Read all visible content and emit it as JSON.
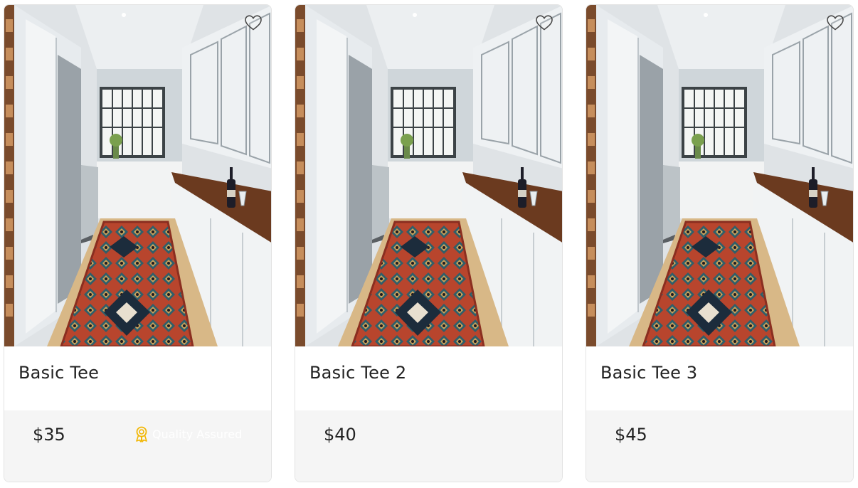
{
  "products": [
    {
      "title": "Basic Tee",
      "price": "$35",
      "badge": "Quality Assured",
      "image": "galley-kitchen-with-red-runner-rug",
      "wishlist_icon": "heart-outline-icon"
    },
    {
      "title": "Basic Tee 2",
      "price": "$40",
      "image": "galley-kitchen-with-red-runner-rug",
      "wishlist_icon": "heart-outline-icon"
    },
    {
      "title": "Basic Tee 3",
      "price": "$45",
      "image": "galley-kitchen-with-red-runner-rug",
      "wishlist_icon": "heart-outline-icon"
    }
  ],
  "colors": {
    "badge_icon": "#f2b705",
    "card_footer_bg": "#f5f5f5",
    "text": "#222222"
  }
}
